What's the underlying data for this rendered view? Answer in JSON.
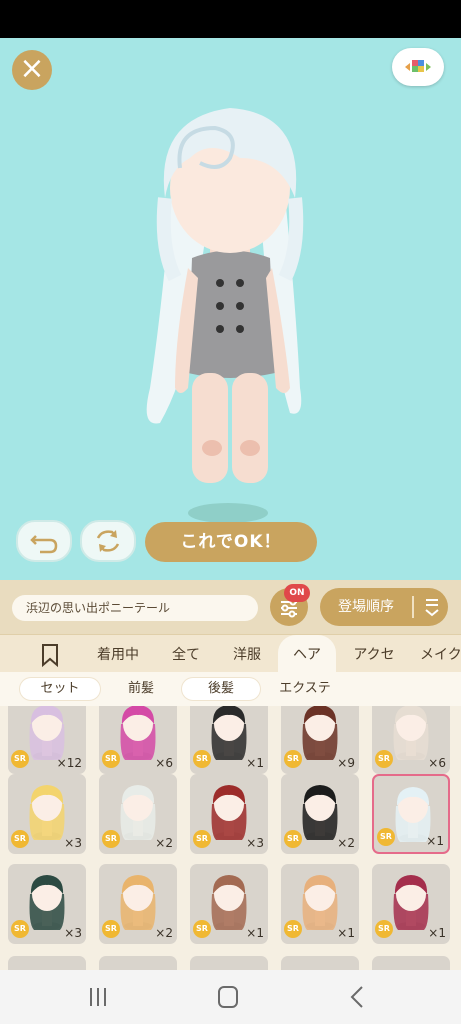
{
  "stage": {
    "ok_label": "これでOK！"
  },
  "toolbar": {
    "name": "浜辺の思い出ポニーテール",
    "filter_badge": "ON",
    "sort_label": "登場順序"
  },
  "tabs": [
    {
      "label": "着用中"
    },
    {
      "label": "全て"
    },
    {
      "label": "洋服"
    },
    {
      "label": "ヘア"
    },
    {
      "label": "アクセ"
    },
    {
      "label": "メイク"
    }
  ],
  "subtabs": [
    {
      "label": "セット"
    },
    {
      "label": "前髪"
    },
    {
      "label": "後髪"
    },
    {
      "label": "エクステ"
    }
  ],
  "items": [
    {
      "rarity": "SR",
      "count": "×12",
      "hair": "#d8bfe0"
    },
    {
      "rarity": "SR",
      "count": "×6",
      "hair": "#d44aa6"
    },
    {
      "rarity": "SR",
      "count": "×1",
      "hair": "#2a2a2a"
    },
    {
      "rarity": "SR",
      "count": "×9",
      "hair": "#6b3226"
    },
    {
      "rarity": "SR",
      "count": "×6",
      "hair": "#e6ddd2"
    },
    {
      "rarity": "SR",
      "count": "×3",
      "hair": "#f3d46d"
    },
    {
      "rarity": "SR",
      "count": "×2",
      "hair": "#e8ece8"
    },
    {
      "rarity": "SR",
      "count": "×3",
      "hair": "#9c2c2a"
    },
    {
      "rarity": "SR",
      "count": "×2",
      "hair": "#1c1c1c"
    },
    {
      "rarity": "SR",
      "count": "×1",
      "hair": "#e4f1f5"
    },
    {
      "rarity": "SR",
      "count": "×3",
      "hair": "#2c4a42"
    },
    {
      "rarity": "SR",
      "count": "×2",
      "hair": "#e9b46c"
    },
    {
      "rarity": "SR",
      "count": "×1",
      "hair": "#a36a52"
    },
    {
      "rarity": "SR",
      "count": "×1",
      "hair": "#e7b07c"
    },
    {
      "rarity": "SR",
      "count": "×1",
      "hair": "#a42e4c"
    }
  ],
  "colors": {
    "accent_gold": "#c9a45f",
    "stage_bg": "#a5e6e5",
    "badge_red": "#e0484a",
    "selected_border": "#e56b8a",
    "sr_badge": "#f0b833"
  },
  "icons": [
    "close-icon",
    "camera-cube-icon",
    "undo-icon",
    "rotate-icon",
    "filter-sliders-icon",
    "sort-icon",
    "bookmark-icon",
    "recent-apps-icon",
    "home-icon",
    "back-icon"
  ]
}
